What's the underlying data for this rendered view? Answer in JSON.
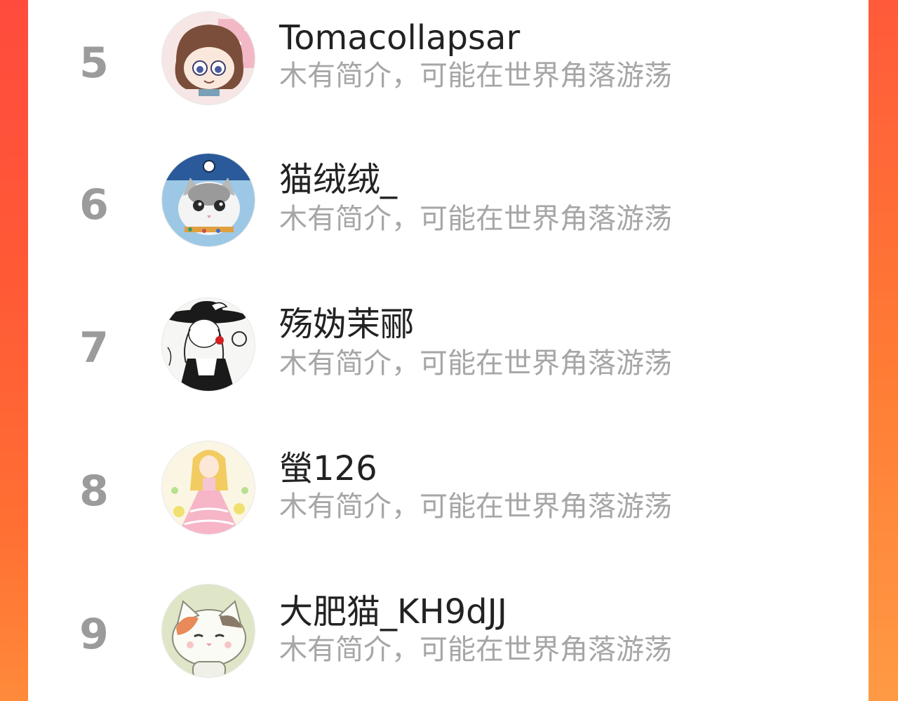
{
  "ranking": {
    "items": [
      {
        "rank": "5",
        "username": "Tomacollapsar",
        "bio": "木有简介，可能在世界角落游荡",
        "avatar_icon": "anime-girl-avatar-icon"
      },
      {
        "rank": "6",
        "username": "猫绒绒_",
        "bio": "木有简介，可能在世界角落游荡",
        "avatar_icon": "cat-avatar-icon"
      },
      {
        "rank": "7",
        "username": "殇妫茉郦",
        "bio": "木有简介，可能在世界角落游荡",
        "avatar_icon": "sketch-girl-hat-avatar-icon"
      },
      {
        "rank": "8",
        "username": "螢126",
        "bio": "木有简介，可能在世界角落游荡",
        "avatar_icon": "princess-avatar-icon"
      },
      {
        "rank": "9",
        "username": "大肥猫_KH9dJJ",
        "bio": "木有简介，可能在世界角落游荡",
        "avatar_icon": "cartoon-cat-avatar-icon"
      }
    ]
  },
  "colors": {
    "background_gradient_top": "#ff4b3d",
    "background_gradient_bottom": "#ff8a3a",
    "panel": "#ffffff",
    "rank_number": "#9b9b9b",
    "username": "#222222",
    "bio": "#a6a6a6"
  }
}
